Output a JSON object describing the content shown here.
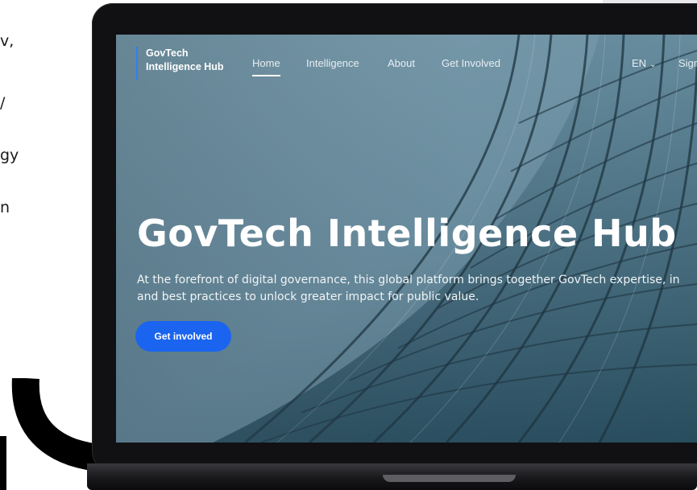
{
  "left_text": [
    "v,",
    "/",
    "gy",
    "n"
  ],
  "nav": {
    "brand_line1": "GovTech",
    "brand_line2": "Intelligence Hub",
    "items": [
      {
        "label": "Home",
        "active": true
      },
      {
        "label": "Intelligence"
      },
      {
        "label": "About"
      },
      {
        "label": "Get Involved"
      }
    ],
    "language": "EN",
    "sign_in_partial": "Sign"
  },
  "hero": {
    "title": "GovTech Intelligence Hub",
    "description_line1": "At the forefront of digital governance, this global platform brings together GovTech expertise, in",
    "description_line2": "and best practices to unlock greater impact for public value.",
    "cta_label": "Get involved"
  },
  "colors": {
    "accent": "#1a64ef",
    "brand_bar": "#2e7df7",
    "laptop_frame": "#111114"
  }
}
